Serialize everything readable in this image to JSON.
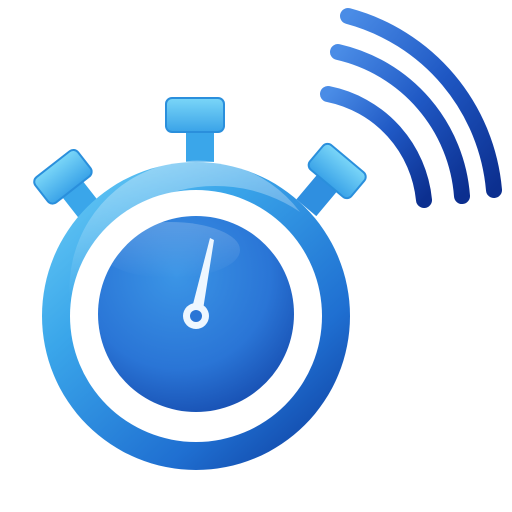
{
  "icon": {
    "name": "stopwatch-wireless-icon",
    "parts": [
      "stopwatch-icon",
      "signal-waves-icon"
    ]
  },
  "colors": {
    "background": "#ffffff",
    "ring_light": "#5cc4f2",
    "ring_mid": "#2f8fe0",
    "ring_dark": "#1246a8",
    "dial_light": "#2f86de",
    "dial_dark": "#1247aa",
    "wave_light": "#3b78de",
    "wave_dark": "#0d3596",
    "needle": "#eef7ff"
  }
}
